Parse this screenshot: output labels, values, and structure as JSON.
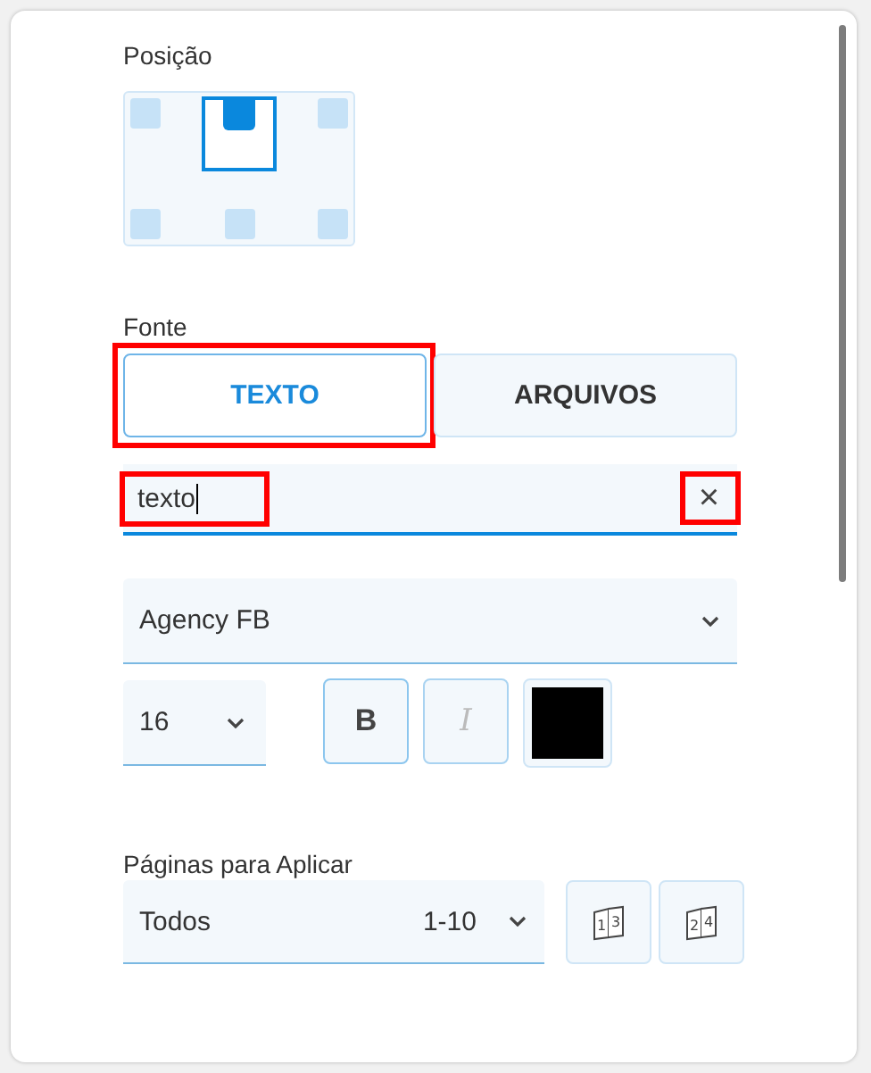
{
  "position": {
    "label": "Posição",
    "slots": [
      {
        "selected": false
      },
      {
        "selected": true
      },
      {
        "selected": false
      },
      {
        "selected": false
      },
      {
        "selected": false
      },
      {
        "selected": false
      }
    ]
  },
  "source": {
    "label": "Fonte",
    "tabs": [
      {
        "label": "TEXTO",
        "selected": true,
        "highlighted": true
      },
      {
        "label": "ARQUIVOS",
        "selected": false,
        "highlighted": false
      }
    ],
    "text_field": {
      "value": "texto",
      "highlighted": true
    },
    "clear_button": {
      "label": "×",
      "highlighted": true
    },
    "font_select": {
      "value": "Agency FB"
    },
    "size_select": {
      "value": "16"
    },
    "style_buttons": [
      {
        "label": "B",
        "kind": "bold",
        "disabled": false
      },
      {
        "label": "I",
        "kind": "italic",
        "disabled": true
      }
    ],
    "color_swatch": {
      "color": "#000000"
    }
  },
  "pages": {
    "label": "Páginas para Aplicar",
    "select": {
      "value": "Todos",
      "range": "1-10"
    },
    "buttons": [
      {
        "numbers": [
          "1",
          "3"
        ]
      },
      {
        "numbers": [
          "2",
          "4"
        ]
      }
    ]
  }
}
